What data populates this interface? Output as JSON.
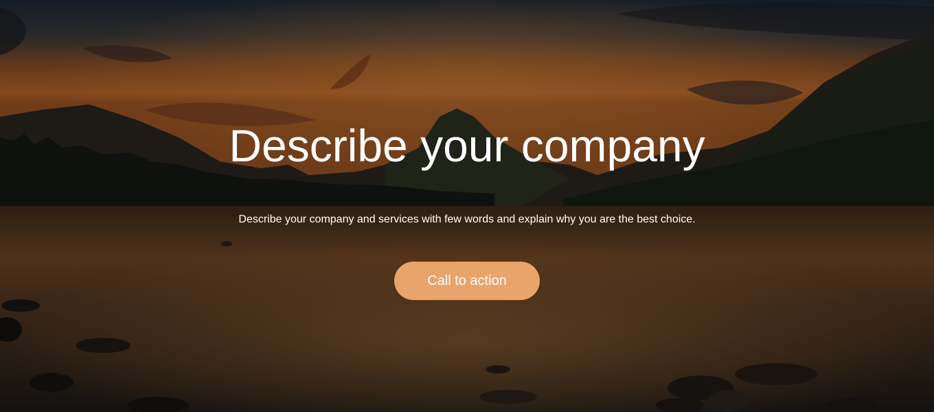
{
  "hero": {
    "title": "Describe your company",
    "subtitle": "Describe your company and services with few words and explain why you are the best choice.",
    "cta_label": "Call to action",
    "cta_color": "#e8a46a",
    "background": "sunset-mountain-lake-photo"
  }
}
